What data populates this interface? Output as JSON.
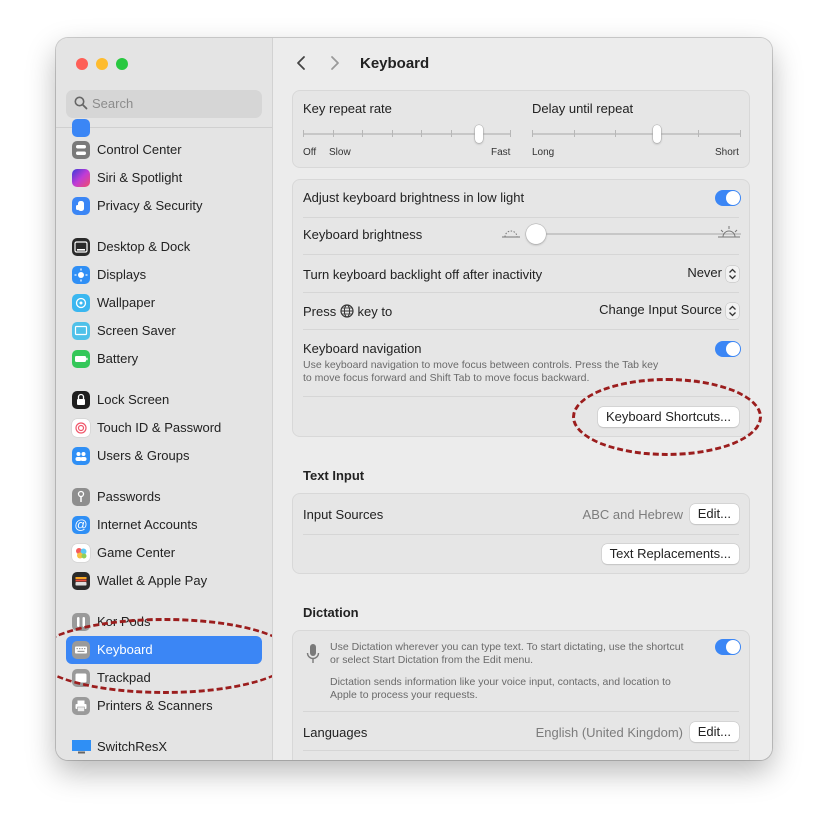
{
  "window": {
    "traffic_lights": {
      "close": "#fe5f57",
      "minimize": "#febc2e",
      "zoom": "#28c840"
    },
    "accent_color": "#3b86f5",
    "annotation_color": "#9b1d1d"
  },
  "sidebar": {
    "search_placeholder": "Search",
    "items": [
      {
        "label": "Control Center",
        "icon": "control-center-icon",
        "color": "#7a7a7a"
      },
      {
        "label": "Siri & Spotlight",
        "icon": "siri-icon",
        "color": "#b23fd6"
      },
      {
        "label": "Privacy & Security",
        "icon": "hand-icon",
        "color": "#3b86f5"
      },
      {
        "label": "Desktop & Dock",
        "icon": "dock-icon",
        "color": "#2a2a2a"
      },
      {
        "label": "Displays",
        "icon": "sun-icon",
        "color": "#2f8ff5"
      },
      {
        "label": "Wallpaper",
        "icon": "flower-icon",
        "color": "#3bb7f0"
      },
      {
        "label": "Screen Saver",
        "icon": "screen-saver-icon",
        "color": "#4fc1e9"
      },
      {
        "label": "Battery",
        "icon": "battery-icon",
        "color": "#34c759"
      },
      {
        "label": "Lock Screen",
        "icon": "lock-icon",
        "color": "#1e1e1e"
      },
      {
        "label": "Touch ID & Password",
        "icon": "fingerprint-icon",
        "color": "#ffffff"
      },
      {
        "label": "Users & Groups",
        "icon": "users-icon",
        "color": "#2f8ff5"
      },
      {
        "label": "Passwords",
        "icon": "key-icon",
        "color": "#8e8e8e"
      },
      {
        "label": "Internet Accounts",
        "icon": "at-icon",
        "color": "#2f8ff5"
      },
      {
        "label": "Game Center",
        "icon": "game-center-icon",
        "color": "#ffffff"
      },
      {
        "label": "Wallet & Apple Pay",
        "icon": "wallet-icon",
        "color": "#2a2a2a"
      },
      {
        "label": "Kor Pods",
        "icon": "airpods-icon",
        "color": "#9a9a9a"
      },
      {
        "label": "Keyboard",
        "icon": "keyboard-icon",
        "color": "#9a9a9a",
        "selected": true
      },
      {
        "label": "Trackpad",
        "icon": "trackpad-icon",
        "color": "#9a9a9a"
      },
      {
        "label": "Printers & Scanners",
        "icon": "printer-icon",
        "color": "#9a9a9a"
      },
      {
        "label": "SwitchResX",
        "icon": "monitor-icon",
        "color": "#2f8ff5"
      }
    ]
  },
  "header": {
    "title": "Keyboard"
  },
  "repeat": {
    "key_repeat_label": "Key repeat rate",
    "key_repeat_left_off": "Off",
    "key_repeat_left_slow": "Slow",
    "key_repeat_right": "Fast",
    "delay_label": "Delay until repeat",
    "delay_left": "Long",
    "delay_right": "Short"
  },
  "settings": {
    "adjust_brightness_label": "Adjust keyboard brightness in low light",
    "adjust_brightness_on": true,
    "brightness_label": "Keyboard brightness",
    "backlight_label": "Turn keyboard backlight off after inactivity",
    "backlight_value": "Never",
    "press_key_prefix": "Press",
    "press_key_suffix": "key to",
    "press_key_value": "Change Input Source",
    "nav_label": "Keyboard navigation",
    "nav_desc_1": "Use keyboard navigation to move focus between controls. Press the Tab key",
    "nav_desc_2": "to move focus forward and Shift Tab to move focus backward.",
    "nav_on": true,
    "shortcuts_button": "Keyboard Shortcuts..."
  },
  "text_input": {
    "section_title": "Text Input",
    "input_sources_label": "Input Sources",
    "input_sources_value": "ABC and Hebrew",
    "edit_button": "Edit...",
    "replacements_button": "Text Replacements..."
  },
  "dictation": {
    "section_title": "Dictation",
    "desc_1": "Use Dictation wherever you can type text. To start dictating, use the shortcut",
    "desc_2": "or select Start Dictation from the Edit menu.",
    "desc_3": "Dictation sends information like your voice input, contacts, and location to",
    "desc_4": "Apple to process your requests.",
    "enabled": true,
    "languages_label": "Languages",
    "languages_value": "English (United Kingdom)",
    "edit_button": "Edit..."
  }
}
